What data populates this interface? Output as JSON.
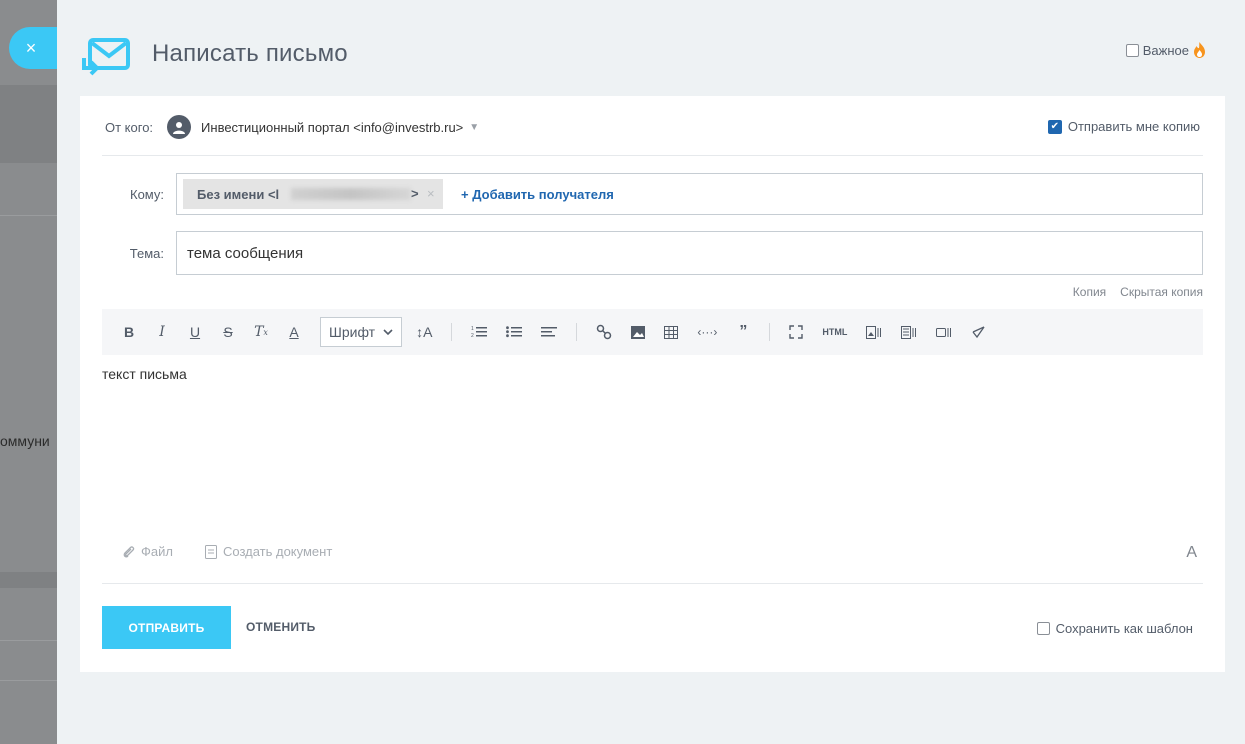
{
  "background": {
    "partial_text": "оммуни",
    "close_label": "×"
  },
  "header": {
    "title": "Написать письмо",
    "important_label": "Важное",
    "important_icon": "flame-icon",
    "accent_color": "#3bc8f5"
  },
  "from": {
    "label": "От кого:",
    "value": "Инвестиционный портал <info@investrb.ru>",
    "copy_me_label": "Отправить мне копию",
    "copy_me_checked": true
  },
  "to": {
    "label": "Кому:",
    "chip_prefix": "Без имени <l",
    "chip_suffix": ">",
    "chip_remove": "×",
    "add_label": "+ Добавить получателя"
  },
  "subject": {
    "label": "Тема:",
    "value": "тема сообщения"
  },
  "cc": {
    "copy_label": "Копия",
    "bcc_label": "Скрытая копия"
  },
  "toolbar": {
    "bold": "B",
    "italic": "I",
    "underline": "U",
    "strike": "S",
    "clear_format": "T",
    "font_color": "A",
    "font_select": "Шрифт",
    "font_size": "↕A",
    "html_label": "HTML"
  },
  "editor": {
    "body": "текст письма"
  },
  "attachments": {
    "file_label": "Файл",
    "create_doc_label": "Создать документ",
    "font_toggle": "A"
  },
  "footer": {
    "send_label": "ОТПРАВИТЬ",
    "cancel_label": "ОТМЕНИТЬ",
    "save_template_label": "Сохранить как шаблон"
  }
}
